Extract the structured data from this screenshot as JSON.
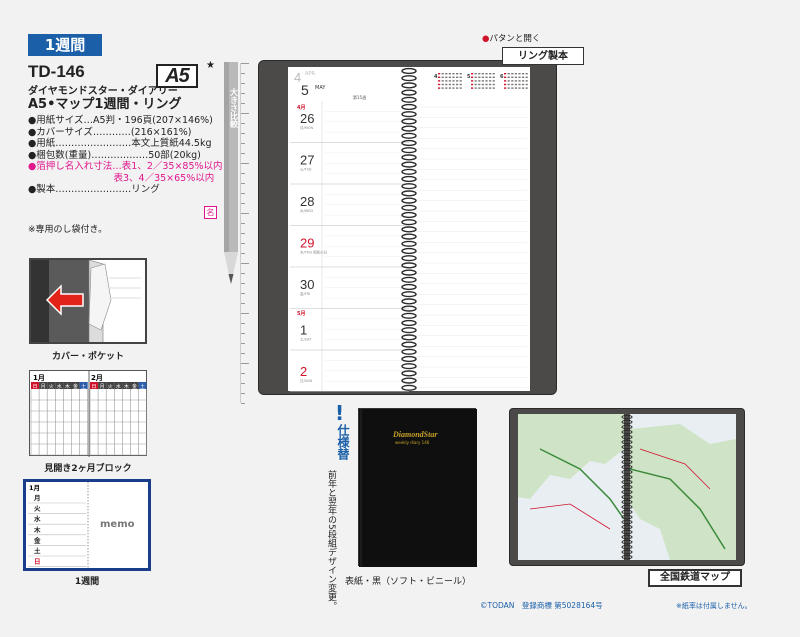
{
  "header": {
    "tag": "1週間",
    "model": "TD-146",
    "subtitle": "ダイヤモンドスター・ダイアリー",
    "name": "A5•マップ1週間・リング",
    "size_badge": "A5",
    "star": "★"
  },
  "specs": [
    {
      "text": "●用紙サイズ…A5判・196頁(207×146%)",
      "pink": false
    },
    {
      "text": "●カバーサイズ…………(216×161%)",
      "pink": false
    },
    {
      "text": "●用紙……………………本文上質紙44.5kg",
      "pink": false
    },
    {
      "text": "●梱包数(重量)………………50部(20kg)",
      "pink": false
    },
    {
      "text": "●箔押し名入れ寸法…表1、2／35×85%以内",
      "pink": true
    },
    {
      "text": "　　　　　　　　　表3、4／35×65%以内",
      "pink": true
    },
    {
      "text": "●製本……………………リング",
      "pink": false
    }
  ],
  "mark_icon": "名",
  "note": "※専用のし袋付き。",
  "pencil_label": "大きさ比較",
  "pocket": {
    "caption": "カバー・ポケット"
  },
  "two_month_block": {
    "months": [
      "1月",
      "2月"
    ],
    "weekdays": [
      "日",
      "月",
      "火",
      "水",
      "木",
      "金",
      "土"
    ],
    "caption": "見開き2ヶ月ブロック"
  },
  "weekly_block": {
    "month": "1月",
    "days": [
      "月",
      "火",
      "水",
      "木",
      "金",
      "土",
      "日"
    ],
    "memo": "memo",
    "caption": "1週間"
  },
  "planner": {
    "top_label_mark": "●",
    "top_label": "パタンと開く",
    "ring_label": "リング製本",
    "header_month_num": "4",
    "header_month_en": "APR.",
    "header_day_num": "5",
    "header_day_en": "MAY",
    "header_week": "第15週",
    "month_tag_apr": "4月",
    "month_tag_may": "5月",
    "days": [
      {
        "num": "26",
        "sub": "月/MON",
        "red": false
      },
      {
        "num": "27",
        "sub": "火/TUE",
        "red": false
      },
      {
        "num": "28",
        "sub": "水/WED",
        "red": false
      },
      {
        "num": "29",
        "sub": "木/THU 昭和の日",
        "red": true
      },
      {
        "num": "30",
        "sub": "金/FRI",
        "red": false
      },
      {
        "num": "1",
        "sub": "土/SAT",
        "red": false
      },
      {
        "num": "2",
        "sub": "日/SUN",
        "red": true
      }
    ],
    "mini_cal_months": [
      "4",
      "5",
      "6"
    ]
  },
  "variant": {
    "mark": "!",
    "label": "仕様替",
    "text": "前年と翌年の5段組デザイン変更。",
    "book_title": "DiamondStar",
    "book_sub": "weekly diary 146",
    "caption": "表紙・黒（ソフト・ビニール）"
  },
  "map_label": "全国鉄道マップ",
  "footer": {
    "left": "©TODAN　登録商標 第5028164号",
    "right": "※紙率は付属しません。"
  },
  "colors": {
    "accent_blue": "#1a5fa8",
    "pink": "#e0168c",
    "red": "#d0142c",
    "cover_dark": "#4b4a49"
  }
}
